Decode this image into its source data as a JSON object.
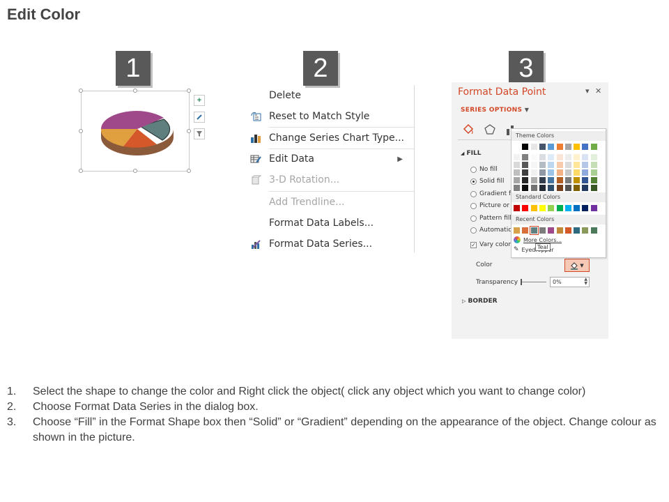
{
  "title": "Edit Color",
  "steps": [
    "1",
    "2",
    "3"
  ],
  "chart_tools": [
    "plus-icon",
    "brush-icon",
    "filter-icon"
  ],
  "context_menu": {
    "items": [
      {
        "label": "Delete",
        "icon": "none",
        "disabled": false
      },
      {
        "label": "Reset to Match Style",
        "icon": "reset-style-icon",
        "disabled": false
      },
      {
        "label": "Change Series Chart Type...",
        "icon": "bar-chart-icon",
        "disabled": false
      },
      {
        "label": "Edit Data",
        "icon": "edit-data-icon",
        "disabled": false,
        "submenu": true
      },
      {
        "label": "3-D Rotation...",
        "icon": "rotation-3d-icon",
        "disabled": true
      },
      {
        "label": "Add Trendline...",
        "icon": "none",
        "disabled": true
      },
      {
        "label": "Format Data Labels...",
        "icon": "none",
        "disabled": false
      },
      {
        "label": "Format Data Series...",
        "icon": "format-series-icon",
        "disabled": false
      }
    ]
  },
  "format_pane": {
    "title": "Format Data Point",
    "series_options": "SERIES OPTIONS",
    "fill_header": "FILL",
    "fill_options": [
      "No fill",
      "Solid fill",
      "Gradient fill",
      "Picture or texture fill",
      "Pattern fill",
      "Automatic"
    ],
    "selected_fill": 1,
    "vary_colors": "Vary colors by point",
    "color_label": "Color",
    "transparency_label": "Transparency",
    "transparency_value": "0%",
    "border_header": "BORDER"
  },
  "palette": {
    "theme_header": "Theme Colors",
    "standard_header": "Standard Colors",
    "recent_header": "Recent Colors",
    "more_colors": "More Colors...",
    "eyedropper": "Eyedropper",
    "tooltip": "Teal",
    "theme_top": [
      "#ffffff",
      "#000000",
      "#e7e6e6",
      "#44546a",
      "#5b9bd5",
      "#ed7d31",
      "#a5a5a5",
      "#ffc000",
      "#4472c4",
      "#70ad47"
    ],
    "standard": [
      "#c00000",
      "#ff0000",
      "#ffc000",
      "#ffff00",
      "#92d050",
      "#00b050",
      "#00b0f0",
      "#0070c0",
      "#002060",
      "#7030a0"
    ],
    "recent": [
      "#d8a24a",
      "#d9703c",
      "#5f8080",
      "#7c7c7c",
      "#a0498a",
      "#c1883a",
      "#d45a2a",
      "#2f6a80",
      "#8a9a5b",
      "#4a7a5a"
    ],
    "recent_selected": 2
  },
  "accent_color": "#d24726",
  "instructions": [
    {
      "num": "1.",
      "text": "Select the shape to change the color and Right click the object( click any object which you want to change color)"
    },
    {
      "num": "2.",
      "text": "Choose Format Data Series in the dialog box."
    },
    {
      "num": "3.",
      "text": "Choose “Fill” in the Format Shape box then “Solid” or “Gradient” depending on the appearance of the object. Change colour as shown in the picture."
    }
  ]
}
